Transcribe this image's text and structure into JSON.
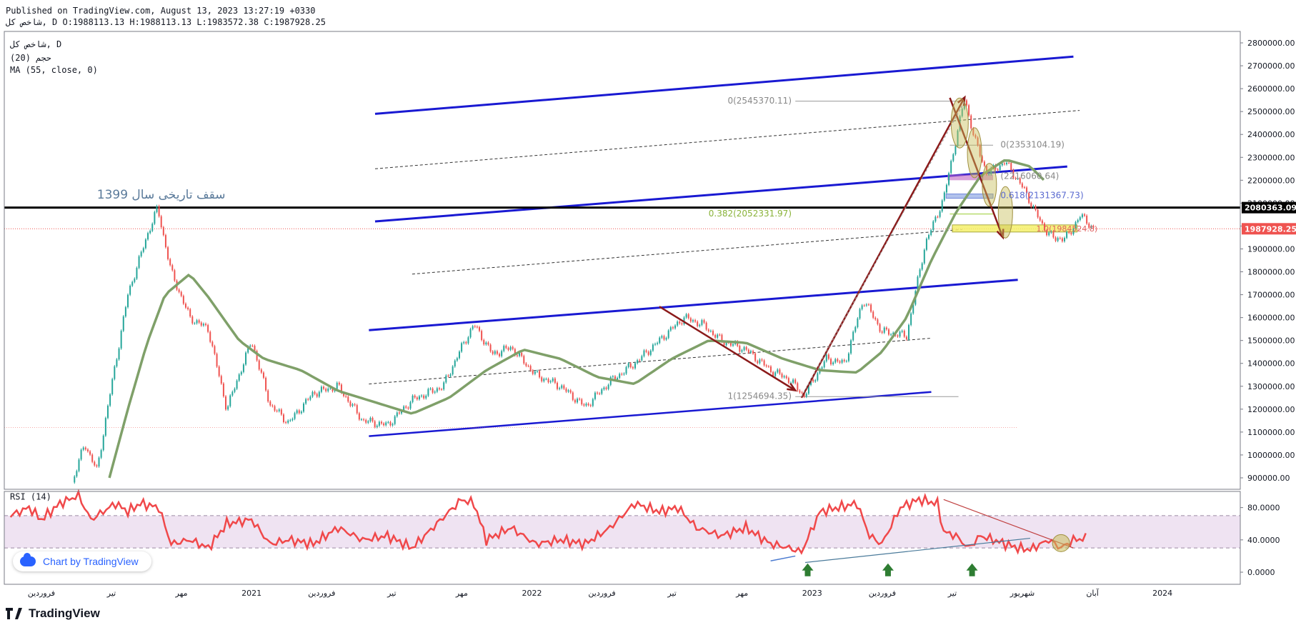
{
  "header": {
    "published": "Published on TradingView.com, August 13, 2023 13:27:19 +0330",
    "ohlc": "شاخص کل, D O:1988113.13 H:1988113.13 L:1983572.38 C:1987928.25"
  },
  "legend": {
    "symbol": "شاخص کل, D",
    "vol": "حجم (20)",
    "ma": "MA (55, close, 0)"
  },
  "branding": {
    "badge": "Chart by TradingView",
    "footer": "TradingView"
  },
  "colors": {
    "up": "#26a69a",
    "down": "#ef5350",
    "ma": "#7fa069",
    "channel": "#1919d2",
    "arrow": "#8b1a1a",
    "rsi": "#f0484a",
    "rsi_band": "#efe3f2",
    "fib_green": "#9acd32",
    "resistance": "#000000"
  },
  "chart_data": [
    {
      "type": "candlestick",
      "title": "شاخص کل, D",
      "ylim": [
        850000,
        2850000
      ],
      "y_ticks": [
        "2800000.00",
        "2700000.00",
        "2600000.00",
        "2500000.00",
        "2400000.00",
        "2300000.00",
        "2200000.00",
        "2100000.00",
        "2000000.00",
        "1900000.00",
        "1800000.00",
        "1700000.00",
        "1600000.00",
        "1500000.00",
        "1400000.00",
        "1300000.00",
        "1200000.00",
        "1100000.00",
        "1000000.00",
        "900000.00"
      ],
      "x_ticks": [
        "فروردین",
        "تیر",
        "مهر",
        "2021",
        "فروردین",
        "تیر",
        "مهر",
        "2022",
        "فروردین",
        "تیر",
        "مهر",
        "2023",
        "فروردین",
        "تیر",
        "شهریور",
        "آبان",
        "2024"
      ],
      "price_path": [
        [
          0.055,
          880000
        ],
        [
          0.065,
          1050000
        ],
        [
          0.075,
          930000
        ],
        [
          0.085,
          1250000
        ],
        [
          0.1,
          1700000
        ],
        [
          0.115,
          1950000
        ],
        [
          0.124,
          2080000
        ],
        [
          0.135,
          1800000
        ],
        [
          0.15,
          1600000
        ],
        [
          0.165,
          1550000
        ],
        [
          0.18,
          1200000
        ],
        [
          0.2,
          1500000
        ],
        [
          0.215,
          1220000
        ],
        [
          0.23,
          1140000
        ],
        [
          0.25,
          1270000
        ],
        [
          0.27,
          1300000
        ],
        [
          0.29,
          1150000
        ],
        [
          0.31,
          1130000
        ],
        [
          0.33,
          1240000
        ],
        [
          0.355,
          1300000
        ],
        [
          0.37,
          1470000
        ],
        [
          0.38,
          1570000
        ],
        [
          0.395,
          1440000
        ],
        [
          0.41,
          1470000
        ],
        [
          0.43,
          1350000
        ],
        [
          0.45,
          1300000
        ],
        [
          0.47,
          1210000
        ],
        [
          0.49,
          1320000
        ],
        [
          0.51,
          1400000
        ],
        [
          0.53,
          1500000
        ],
        [
          0.55,
          1600000
        ],
        [
          0.565,
          1570000
        ],
        [
          0.58,
          1500000
        ],
        [
          0.6,
          1460000
        ],
        [
          0.62,
          1370000
        ],
        [
          0.635,
          1330000
        ],
        [
          0.647,
          1260000
        ],
        [
          0.665,
          1420000
        ],
        [
          0.68,
          1400000
        ],
        [
          0.695,
          1680000
        ],
        [
          0.71,
          1540000
        ],
        [
          0.73,
          1520000
        ],
        [
          0.745,
          1920000
        ],
        [
          0.76,
          2120000
        ],
        [
          0.777,
          2560000
        ],
        [
          0.785,
          2380000
        ],
        [
          0.795,
          2230000
        ],
        [
          0.81,
          2280000
        ],
        [
          0.825,
          2160000
        ],
        [
          0.84,
          2000000
        ],
        [
          0.85,
          1940000
        ],
        [
          0.862,
          1960000
        ],
        [
          0.87,
          2050000
        ],
        [
          0.877,
          2010000
        ],
        [
          0.882,
          1987928
        ]
      ],
      "ma_path": [
        [
          0.085,
          900000
        ],
        [
          0.1,
          1200000
        ],
        [
          0.115,
          1480000
        ],
        [
          0.13,
          1700000
        ],
        [
          0.15,
          1790000
        ],
        [
          0.165,
          1690000
        ],
        [
          0.19,
          1500000
        ],
        [
          0.21,
          1420000
        ],
        [
          0.24,
          1370000
        ],
        [
          0.27,
          1280000
        ],
        [
          0.3,
          1230000
        ],
        [
          0.33,
          1180000
        ],
        [
          0.36,
          1250000
        ],
        [
          0.39,
          1370000
        ],
        [
          0.42,
          1460000
        ],
        [
          0.45,
          1420000
        ],
        [
          0.48,
          1340000
        ],
        [
          0.51,
          1310000
        ],
        [
          0.54,
          1420000
        ],
        [
          0.57,
          1500000
        ],
        [
          0.6,
          1490000
        ],
        [
          0.63,
          1420000
        ],
        [
          0.66,
          1370000
        ],
        [
          0.69,
          1360000
        ],
        [
          0.71,
          1450000
        ],
        [
          0.73,
          1600000
        ],
        [
          0.75,
          1850000
        ],
        [
          0.77,
          2060000
        ],
        [
          0.79,
          2220000
        ],
        [
          0.81,
          2290000
        ],
        [
          0.83,
          2260000
        ],
        [
          0.845,
          2180000
        ]
      ],
      "current_price": "1987928.25",
      "resistance_label": "2080363.09",
      "annotations": {
        "historic_peak": "سقف تاریخی سال 1399",
        "fib_0_high": "0(2545370.11)",
        "fib_0_mid": "0(2353104.19)",
        "fib_mid_b": "(2216060.64)",
        "fib_618": "0.618(2131367.73)",
        "fib_382": "0.382(2052331.97)",
        "fib_1": "1(1254694.35)",
        "fib_box": "1.0(1984524.8)"
      }
    },
    {
      "type": "line",
      "title": "RSI (14)",
      "ylim": [
        -15,
        100
      ],
      "y_ticks": [
        "80.0000",
        "40.0000",
        "0.0000"
      ],
      "band": [
        30,
        70
      ],
      "rsi_path": [
        [
          0.005,
          70
        ],
        [
          0.02,
          80
        ],
        [
          0.03,
          65
        ],
        [
          0.045,
          85
        ],
        [
          0.06,
          95
        ],
        [
          0.07,
          65
        ],
        [
          0.08,
          75
        ],
        [
          0.09,
          85
        ],
        [
          0.1,
          75
        ],
        [
          0.11,
          85
        ],
        [
          0.125,
          80
        ],
        [
          0.135,
          35
        ],
        [
          0.15,
          40
        ],
        [
          0.165,
          30
        ],
        [
          0.18,
          60
        ],
        [
          0.2,
          65
        ],
        [
          0.215,
          35
        ],
        [
          0.23,
          40
        ],
        [
          0.25,
          35
        ],
        [
          0.27,
          55
        ],
        [
          0.29,
          40
        ],
        [
          0.31,
          45
        ],
        [
          0.33,
          30
        ],
        [
          0.35,
          60
        ],
        [
          0.37,
          90
        ],
        [
          0.38,
          85
        ],
        [
          0.39,
          40
        ],
        [
          0.41,
          55
        ],
        [
          0.43,
          35
        ],
        [
          0.45,
          40
        ],
        [
          0.47,
          35
        ],
        [
          0.49,
          55
        ],
        [
          0.51,
          85
        ],
        [
          0.53,
          75
        ],
        [
          0.545,
          80
        ],
        [
          0.56,
          55
        ],
        [
          0.58,
          45
        ],
        [
          0.6,
          55
        ],
        [
          0.62,
          35
        ],
        [
          0.635,
          30
        ],
        [
          0.645,
          25
        ],
        [
          0.66,
          75
        ],
        [
          0.675,
          80
        ],
        [
          0.69,
          85
        ],
        [
          0.7,
          45
        ],
        [
          0.71,
          35
        ],
        [
          0.725,
          80
        ],
        [
          0.74,
          90
        ],
        [
          0.755,
          85
        ],
        [
          0.76,
          50
        ],
        [
          0.77,
          45
        ],
        [
          0.78,
          30
        ],
        [
          0.79,
          45
        ],
        [
          0.81,
          35
        ],
        [
          0.82,
          30
        ],
        [
          0.83,
          28
        ],
        [
          0.845,
          40
        ],
        [
          0.855,
          30
        ],
        [
          0.865,
          40
        ],
        [
          0.875,
          42
        ]
      ]
    }
  ]
}
